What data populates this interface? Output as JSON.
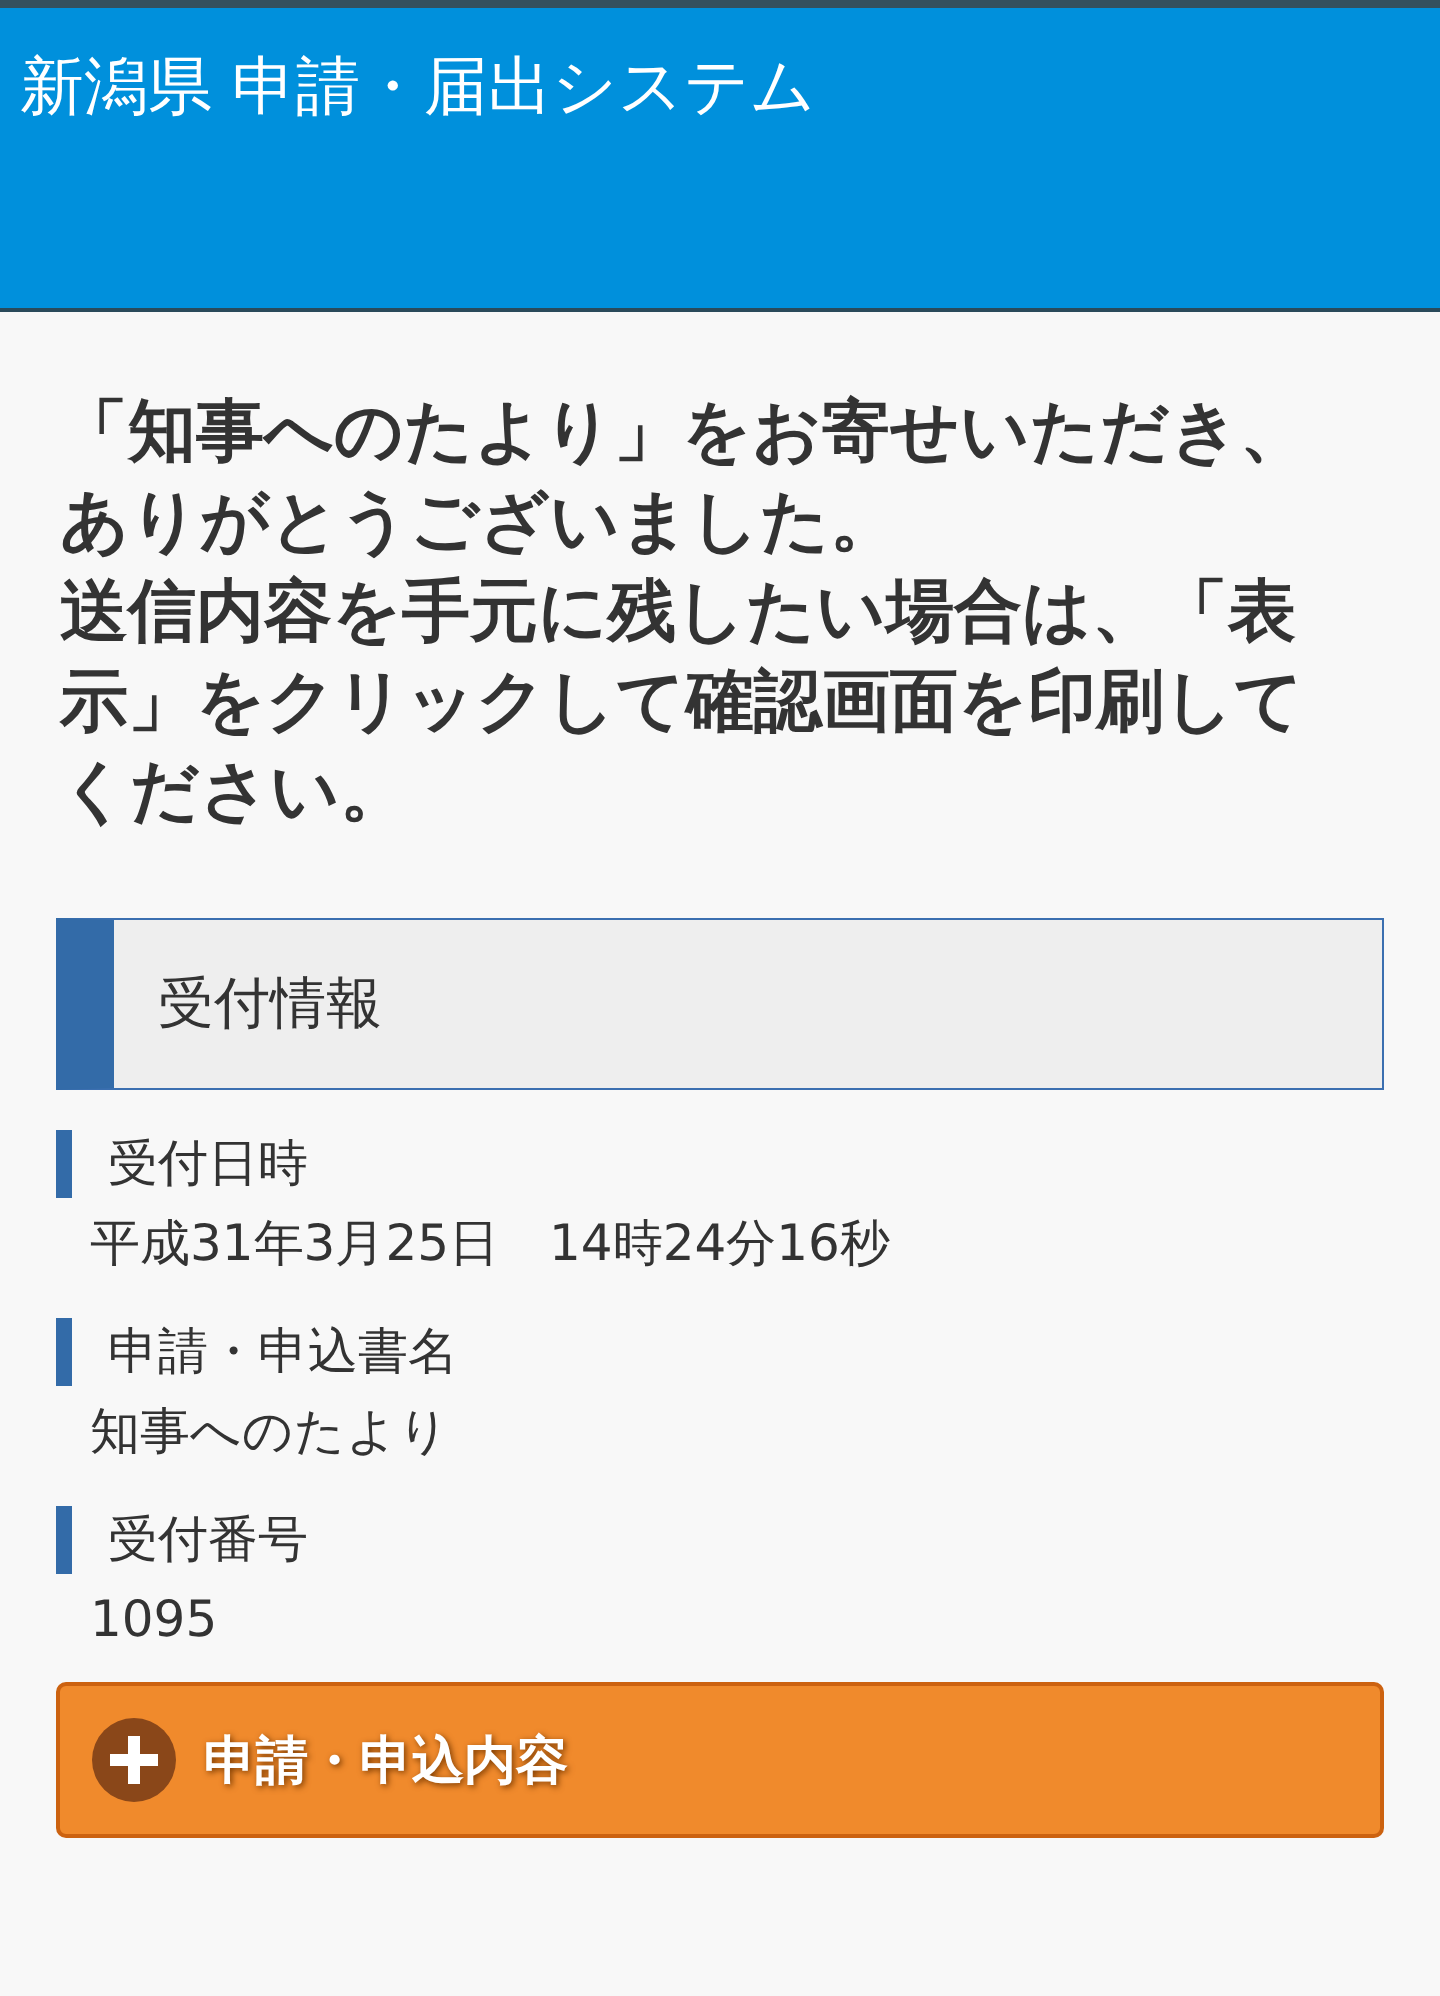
{
  "header": {
    "title": "新潟県 申請・届出システム"
  },
  "message": [
    "「知事へのたより」をお寄せいただき、ありがとうございました。",
    "送信内容を手元に残したい場合は、「表示」をクリックして確認画面を印刷してください。"
  ],
  "section": {
    "title": "受付情報"
  },
  "fields": [
    {
      "label": "受付日時",
      "value": "平成31年3月25日　14時24分16秒"
    },
    {
      "label": "申請・申込書名",
      "value": "知事へのたより"
    },
    {
      "label": "受付番号",
      "value": "1095"
    }
  ],
  "expand_button": {
    "label": "申請・申込内容",
    "expanded": false
  }
}
